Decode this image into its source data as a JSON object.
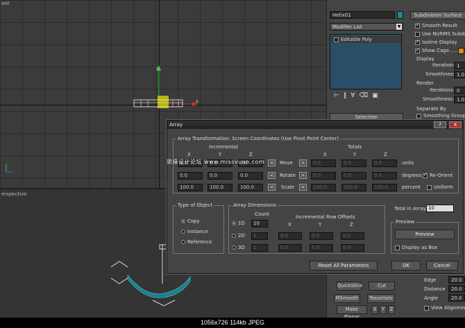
{
  "viewports": {
    "top_label": "ont",
    "bottom_label": "erspective"
  },
  "command_panel": {
    "object_name": "Helix01",
    "modifier_list": "Modifier List",
    "stack_item": "Editable Poly",
    "selection_rollout": "Selection",
    "subdivision_rollout": "Subdivision Surface",
    "smooth_result": "Smooth Result",
    "use_nurms": "Use NURMS Subdiv",
    "isoline_display": "Isoline Display",
    "show_cage": "Show Cage......",
    "display_label": "Display",
    "iterations_label": "Iterations:",
    "iterations_value": "1",
    "smoothness_label": "Smoothness:",
    "smoothness_value": "1.0",
    "render_label": "Render",
    "render_iterations_label": "Iterations:",
    "render_iterations_value": "0",
    "render_smoothness_label": "Smoothness:",
    "render_smoothness_value": "1.0",
    "separate_by": "Separate By",
    "smoothing_groups": "Smoothing Groups",
    "quickslice": "QuickSlice",
    "cut": "Cut",
    "msmooth": "MSmooth",
    "tessellate": "Tessellate",
    "make_planar": "Make Planar",
    "x": "X",
    "y": "Y",
    "z": "Z",
    "edge_label": "Edge",
    "distance_label": "Distance",
    "angle_label": "Angle",
    "view_align": "View Alignment",
    "view_align_value": "20.0",
    "distance_value": "20.0",
    "angle_value": "20.0",
    "accent_color": "#e08a1e"
  },
  "dialog": {
    "title": "Array",
    "transform_group": "Array Transformation: Screen Coordinates (Use Pivot Point Center)",
    "incremental": "Incremental",
    "totals": "Totals",
    "col_x": "X",
    "col_y": "Y",
    "col_z": "Z",
    "move_label": "Move",
    "rotate_label": "Rotate",
    "scale_label": "Scale",
    "units": "units",
    "degrees": "degrees",
    "percent": "percent",
    "re_orient": "Re-Orient",
    "uniform": "Uniform",
    "move_inc": [
      "0.0",
      "0.0",
      "0.0"
    ],
    "move_tot": [
      "0.0",
      "0.0",
      "0.0"
    ],
    "rotate_inc": [
      "0.0",
      "0.0",
      "0.0"
    ],
    "rotate_tot": [
      "0.0",
      "0.0",
      "0.0"
    ],
    "scale_inc": [
      "100.0",
      "100.0",
      "100.0"
    ],
    "scale_tot": [
      "100.0",
      "100.0",
      "100.0"
    ],
    "type_group": "Type of Object",
    "copy": "Copy",
    "instance": "Instance",
    "reference": "Reference",
    "dimensions_group": "Array Dimensions",
    "count": "Count",
    "row_offsets": "Incremental Row Offsets",
    "dim_1d": "1D",
    "dim_2d": "2D",
    "dim_3d": "3D",
    "count_1d": "10",
    "count_2d": "1",
    "count_3d": "1",
    "offsets_2d": [
      "0.0",
      "0.0",
      "0.0"
    ],
    "offsets_3d": [
      "0.0",
      "0.0",
      "0.0"
    ],
    "total_in_array_label": "Total in Array:",
    "total_in_array": "10",
    "preview_group": "Preview",
    "preview_button": "Preview",
    "display_as_box": "Display as Box",
    "reset_button": "Reset All Parameters",
    "ok_button": "OK",
    "cancel_button": "Cancel",
    "help_button": "?",
    "close_button": "X"
  },
  "watermark": "思缘设计论坛 www.missvuan.com",
  "status_bar": "1056x726  114kb  JPEG"
}
